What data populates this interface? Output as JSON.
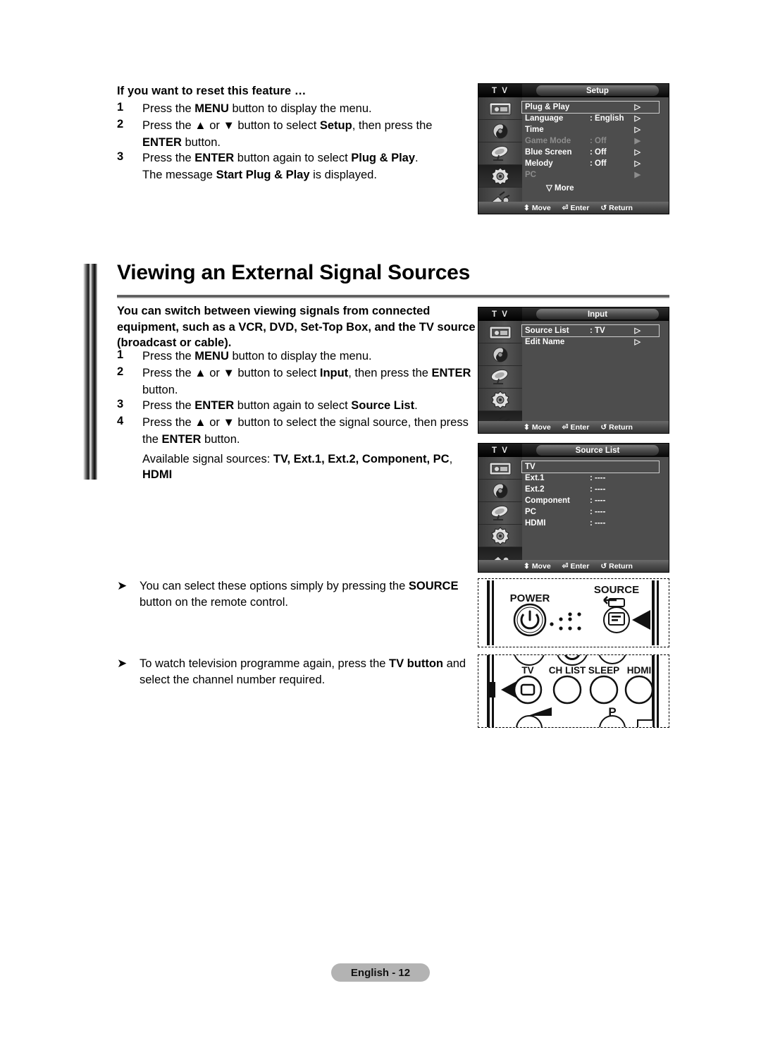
{
  "top_section": {
    "title": "If you want to reset this feature …",
    "steps": [
      {
        "num": "1",
        "text": "Press the MENU button to display the menu."
      },
      {
        "num": "2",
        "text": "Press the ▲ or ▼ button to select Setup, then press the"
      },
      {
        "num": "3",
        "text": "Press the ENTER button again to select Plug & Play."
      }
    ],
    "step2_cont": "ENTER button.",
    "step3_cont": "The message Start Plug & Play is displayed."
  },
  "heading": "Viewing an External Signal Sources",
  "intro": "You can switch between viewing signals from connected equipment, such as a VCR, DVD, Set-Top Box, and the TV source (broadcast or cable).",
  "main_steps": [
    {
      "num": "1",
      "text": "Press the MENU button to display the menu."
    },
    {
      "num": "2",
      "text": "Press the ▲ or ▼ button to select Input, then press the ENTER"
    },
    {
      "num": "3",
      "text": "Press the ENTER button again to select Source List."
    },
    {
      "num": "4",
      "text": "Press the ▲ or ▼ button to select the signal source, then press"
    }
  ],
  "step2_cont": "button.",
  "step4_cont": "the ENTER button.",
  "available_line1": "Available signal sources: TV, Ext.1, Ext.2, Component, PC,",
  "available_line2": "HDMI",
  "bullets": [
    {
      "arrow": "➤",
      "line1": "You can select these options simply by pressing the SOURCE",
      "line2": "button on the remote control."
    },
    {
      "arrow": "➤",
      "line1": "To watch television programme again, press the TV button and",
      "line2": "select the channel number required."
    }
  ],
  "osd_setup": {
    "tv_label": "T V",
    "title": "Setup",
    "rows": [
      {
        "label": "Plug & Play",
        "value": "",
        "arrow": "▷",
        "dim": false,
        "highlight": true
      },
      {
        "label": "Language",
        "value": ": English",
        "arrow": "▷",
        "dim": false,
        "highlight": false
      },
      {
        "label": "Time",
        "value": "",
        "arrow": "▷",
        "dim": false,
        "highlight": false
      },
      {
        "label": "Game Mode",
        "value": ": Off",
        "arrow": "▶",
        "dim": true,
        "highlight": false
      },
      {
        "label": "Blue Screen",
        "value": ": Off",
        "arrow": "▷",
        "dim": false,
        "highlight": false
      },
      {
        "label": "Melody",
        "value": ": Off",
        "arrow": "▷",
        "dim": false,
        "highlight": false
      },
      {
        "label": "PC",
        "value": "",
        "arrow": "▶",
        "dim": true,
        "highlight": false
      }
    ],
    "more": "▽  More",
    "footer": {
      "move": "Move",
      "enter": "Enter",
      "return": "Return"
    }
  },
  "osd_input": {
    "tv_label": "T V",
    "title": "Input",
    "rows": [
      {
        "label": "Source List",
        "value": ": TV",
        "arrow": "▷",
        "dim": false,
        "highlight": true
      },
      {
        "label": "Edit Name",
        "value": "",
        "arrow": "▷",
        "dim": false,
        "highlight": false
      }
    ],
    "footer": {
      "move": "Move",
      "enter": "Enter",
      "return": "Return"
    }
  },
  "osd_source_list": {
    "tv_label": "T V",
    "title": "Source List",
    "rows": [
      {
        "label": "TV",
        "value": "",
        "arrow": "",
        "dim": false,
        "highlight": true
      },
      {
        "label": "Ext.1",
        "value": ": ----",
        "arrow": "",
        "dim": false,
        "highlight": false
      },
      {
        "label": "Ext.2",
        "value": ": ----",
        "arrow": "",
        "dim": false,
        "highlight": false
      },
      {
        "label": "Component",
        "value": ": ----",
        "arrow": "",
        "dim": false,
        "highlight": false
      },
      {
        "label": "PC",
        "value": ": ----",
        "arrow": "",
        "dim": false,
        "highlight": false
      },
      {
        "label": "HDMI",
        "value": ": ----",
        "arrow": "",
        "dim": false,
        "highlight": false
      }
    ],
    "footer": {
      "move": "Move",
      "enter": "Enter",
      "return": "Return"
    }
  },
  "remote_top": {
    "power_label": "POWER",
    "source_label": "SOURCE"
  },
  "remote_bottom": {
    "buttons": [
      "TV",
      "CH LIST",
      "SLEEP",
      "HDMI"
    ],
    "p_label": "P"
  },
  "footer_page": "English - 12"
}
